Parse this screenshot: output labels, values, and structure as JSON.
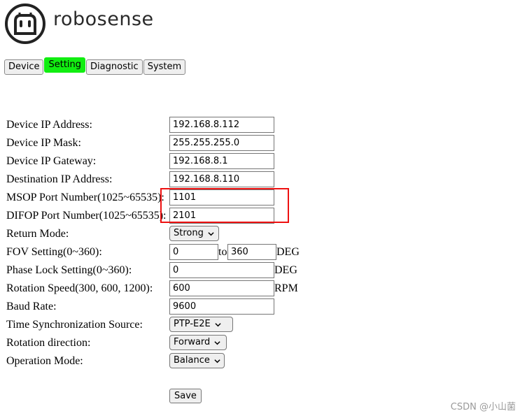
{
  "brand": {
    "name": "robosense"
  },
  "tabs": [
    "Device",
    "Setting",
    "Diagnostic",
    "System"
  ],
  "active_tab": "Setting",
  "colors": {
    "active_tab": "#11ee11",
    "highlight_box": "#ee1111"
  },
  "form": {
    "device_ip": {
      "label": "Device IP Address:",
      "value": "192.168.8.112"
    },
    "device_mask": {
      "label": "Device IP Mask:",
      "value": "255.255.255.0"
    },
    "device_gateway": {
      "label": "Device IP Gateway:",
      "value": "192.168.8.1"
    },
    "dest_ip": {
      "label": "Destination IP Address:",
      "value": "192.168.8.110"
    },
    "msop_port": {
      "label": "MSOP Port Number(1025~65535):",
      "value": "1101"
    },
    "difop_port": {
      "label": "DIFOP Port Number(1025~65535):",
      "value": "2101"
    },
    "return_mode": {
      "label": "Return Mode:",
      "value": "Strong"
    },
    "fov": {
      "label": "FOV Setting(0~360):",
      "start": "0",
      "to": "to",
      "end": "360",
      "unit": "DEG"
    },
    "phase_lock": {
      "label": "Phase Lock Setting(0~360):",
      "value": "0",
      "unit": "DEG"
    },
    "rotation_speed": {
      "label": "Rotation Speed(300, 600, 1200):",
      "value": "600",
      "unit": "RPM"
    },
    "baud_rate": {
      "label": "Baud Rate:",
      "value": "9600"
    },
    "time_sync": {
      "label": "Time Synchronization Source:",
      "value": "PTP-E2E"
    },
    "rotation_direction": {
      "label": "Rotation direction:",
      "value": "Forward"
    },
    "operation_mode": {
      "label": "Operation Mode:",
      "value": "Balance"
    },
    "save_label": "Save"
  },
  "watermark": "CSDN @小山菌"
}
